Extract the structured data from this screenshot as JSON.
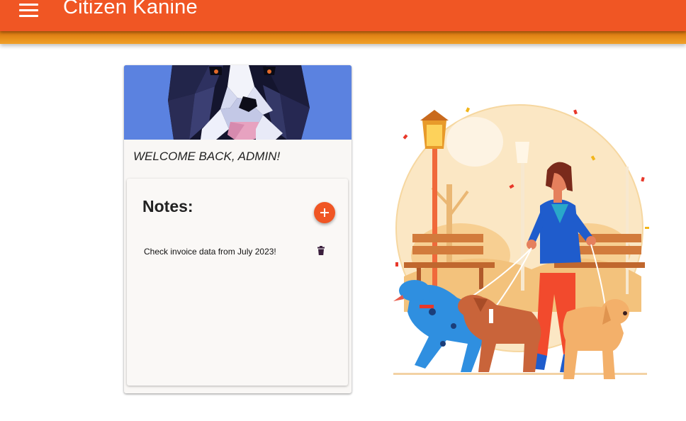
{
  "appbar": {
    "title": "Citizen Kanine",
    "menu_icon": "hamburger-menu-icon"
  },
  "colors": {
    "appbar": "#f05624",
    "stripe": "#e8901c",
    "accent": "#f05624",
    "hero_bg": "#5b82e0",
    "trash": "#3a1f3d"
  },
  "welcome_card": {
    "hero_image": "low-poly-dog-portrait",
    "greeting": "WELCOME BACK, ADMIN!"
  },
  "notes": {
    "heading": "Notes:",
    "add_icon": "plus-icon",
    "items": [
      {
        "text": "Check invoice data from July 2023!",
        "delete_icon": "trash-icon"
      }
    ]
  },
  "illustration": {
    "subject": "woman-walking-dogs-in-park"
  }
}
